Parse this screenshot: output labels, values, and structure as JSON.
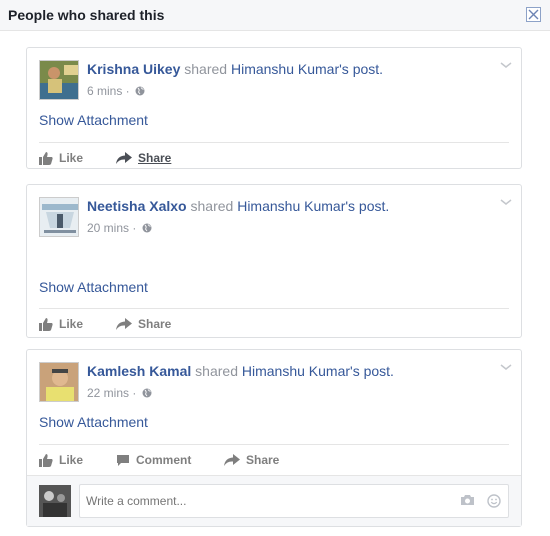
{
  "dialog": {
    "title": "People who shared this"
  },
  "posts": [
    {
      "actor": "Krishna Uikey",
      "verb": " shared ",
      "owner": "Himanshu Kumar",
      "owner_suffix": "'s post.",
      "time": "6 mins · ",
      "attachment_label": "Show Attachment",
      "like_label": "Like",
      "share_label": "Share"
    },
    {
      "actor": "Neetisha Xalxo",
      "verb": " shared ",
      "owner": "Himanshu Kumar",
      "owner_suffix": "'s post.",
      "time": "20 mins · ",
      "attachment_label": "Show Attachment",
      "like_label": "Like",
      "share_label": "Share"
    },
    {
      "actor": "Kamlesh Kamal",
      "verb": " shared ",
      "owner": "Himanshu Kumar",
      "owner_suffix": "'s post.",
      "time": "22 mins · ",
      "attachment_label": "Show Attachment",
      "like_label": "Like",
      "comment_label": "Comment",
      "share_label": "Share",
      "comment_placeholder": "Write a comment..."
    }
  ],
  "colors": {
    "link": "#365899",
    "muted": "#90949c",
    "border": "#dddfe2"
  }
}
